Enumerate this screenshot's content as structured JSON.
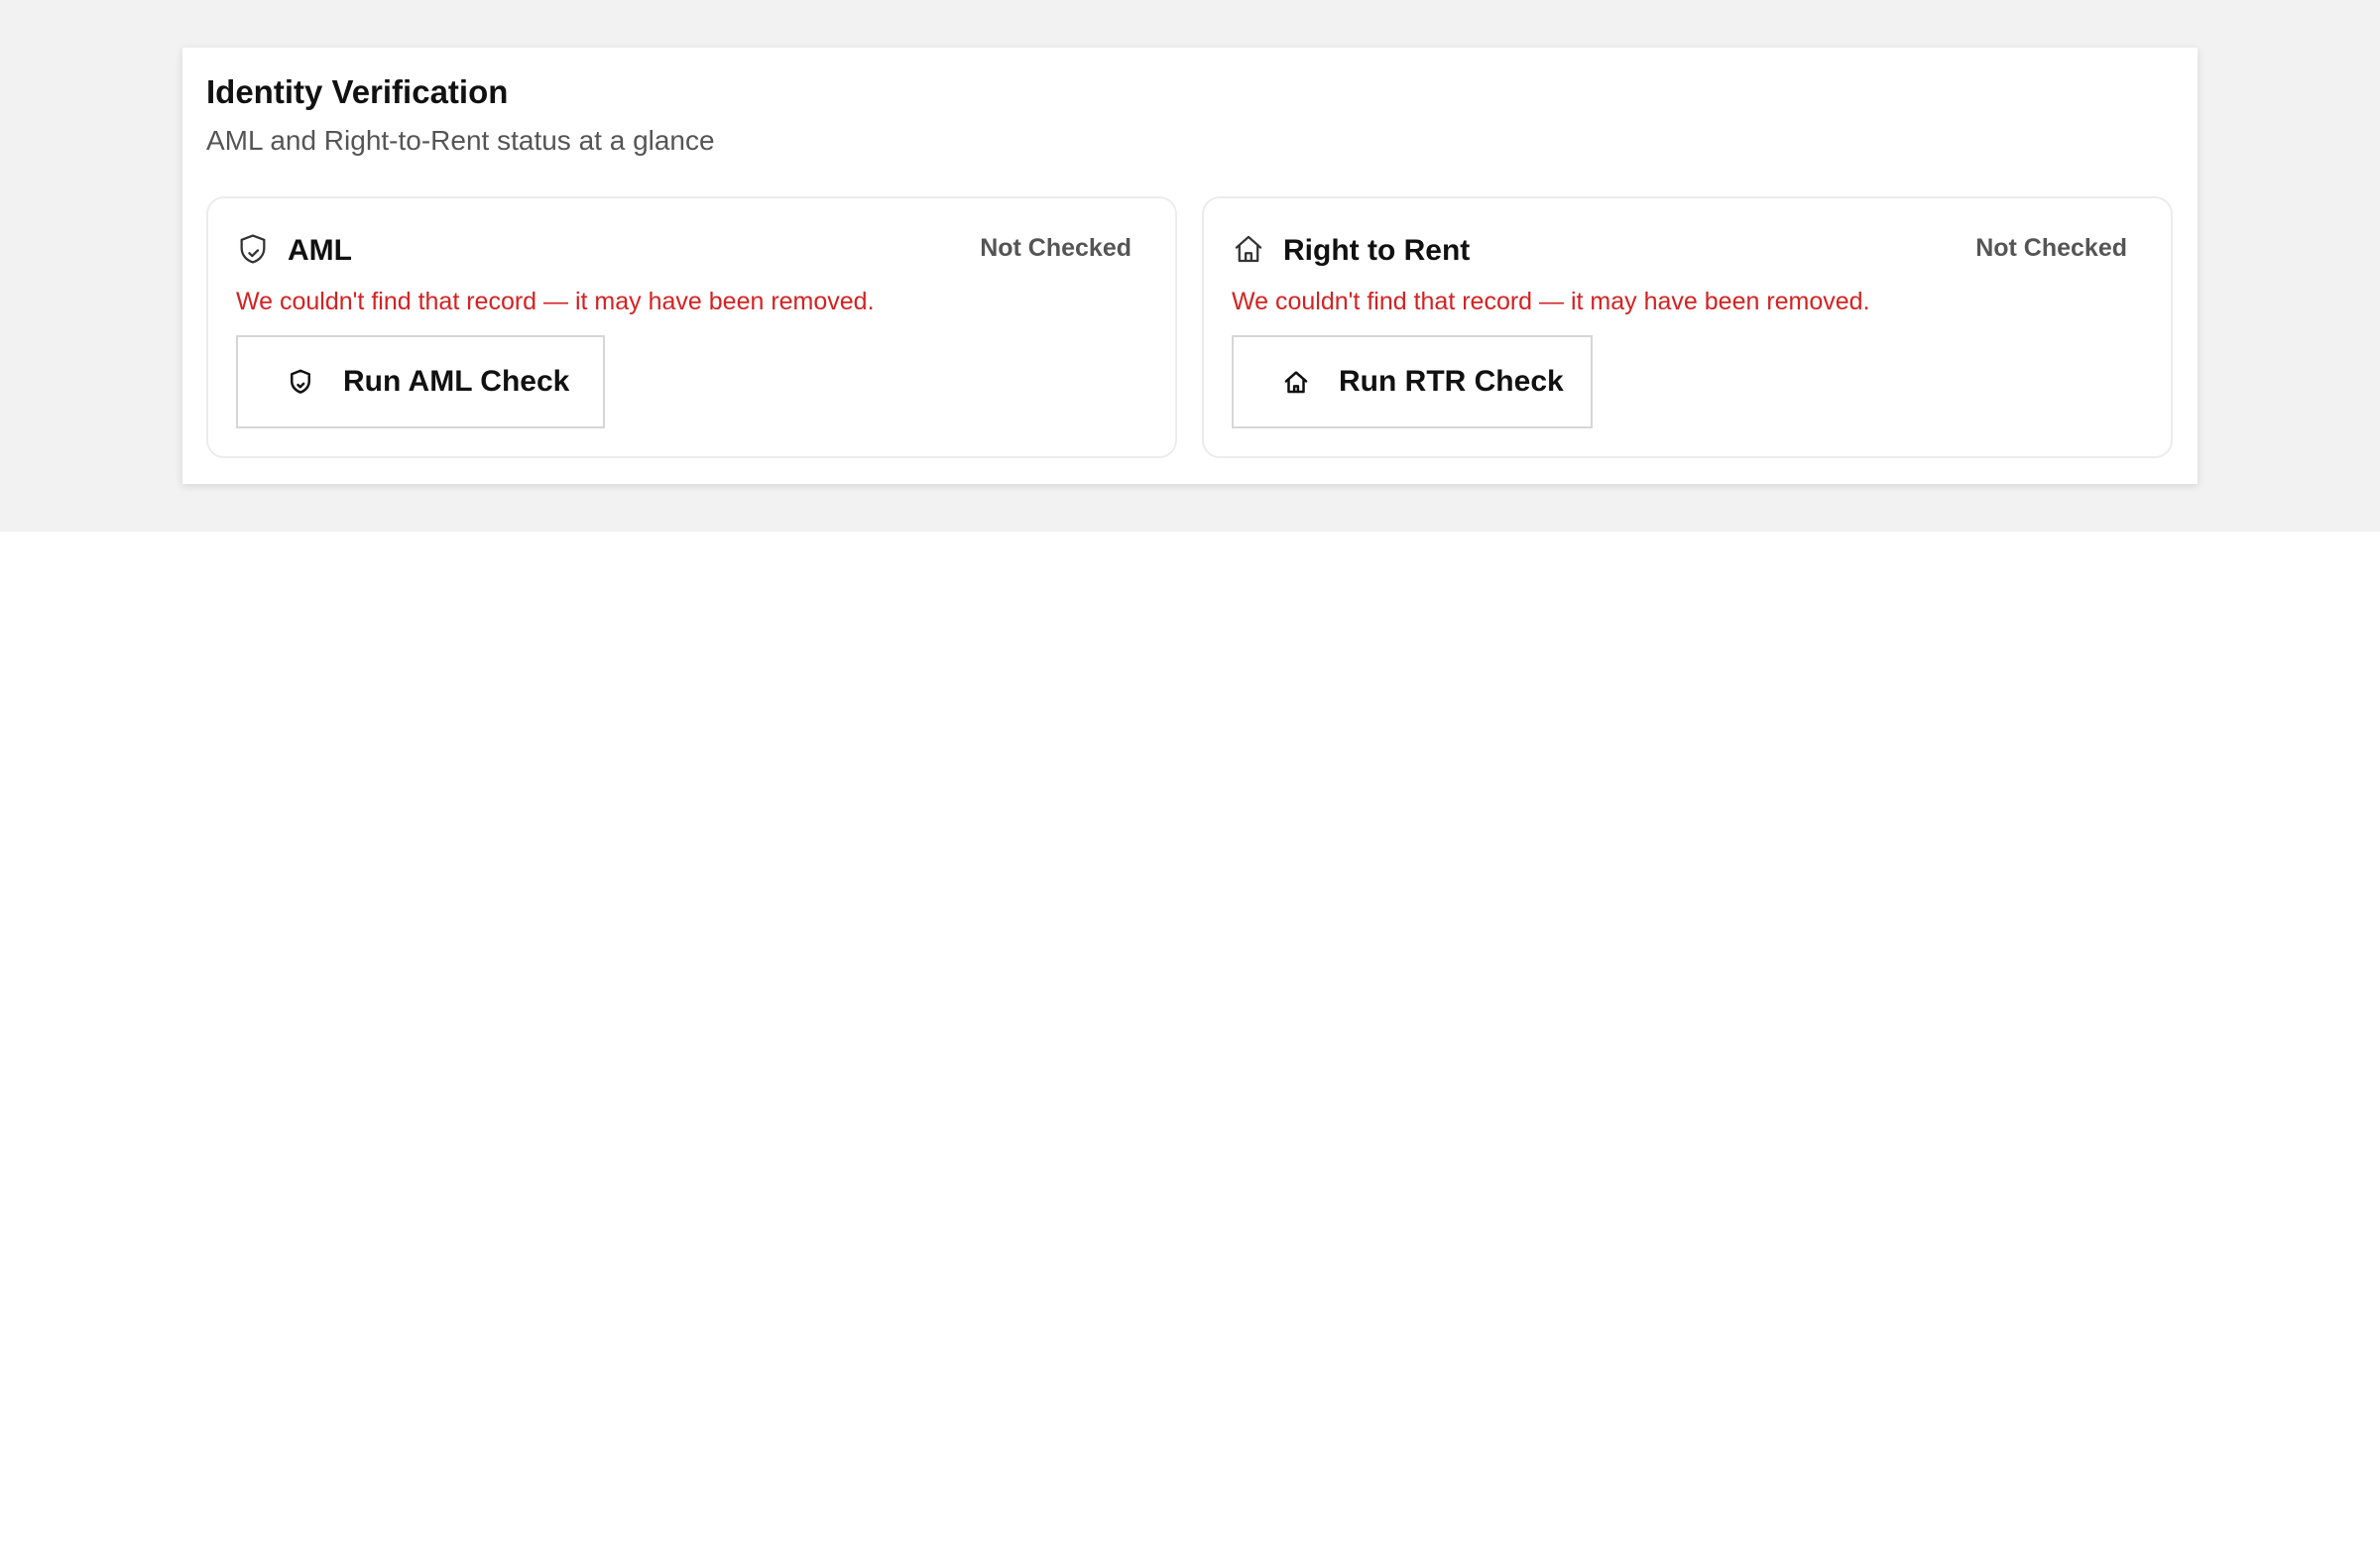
{
  "panel": {
    "title": "Identity Verification",
    "subtitle": "AML and Right-to-Rent status at a glance"
  },
  "cards": {
    "aml": {
      "icon": "shield-icon",
      "name": "AML",
      "status": "Not Checked",
      "error": "We couldn't find that record — it may have been removed.",
      "button_label": "Run AML Check",
      "button_icon": "shield-icon"
    },
    "rtr": {
      "icon": "home-icon",
      "name": "Right to Rent",
      "status": "Not Checked",
      "error": "We couldn't find that record — it may have been removed.",
      "button_label": "Run RTR Check",
      "button_icon": "home-icon"
    }
  },
  "colors": {
    "page_background": "#f2f2f2",
    "error_text": "#d32222",
    "status_text": "#555555",
    "border": "#ececec"
  }
}
